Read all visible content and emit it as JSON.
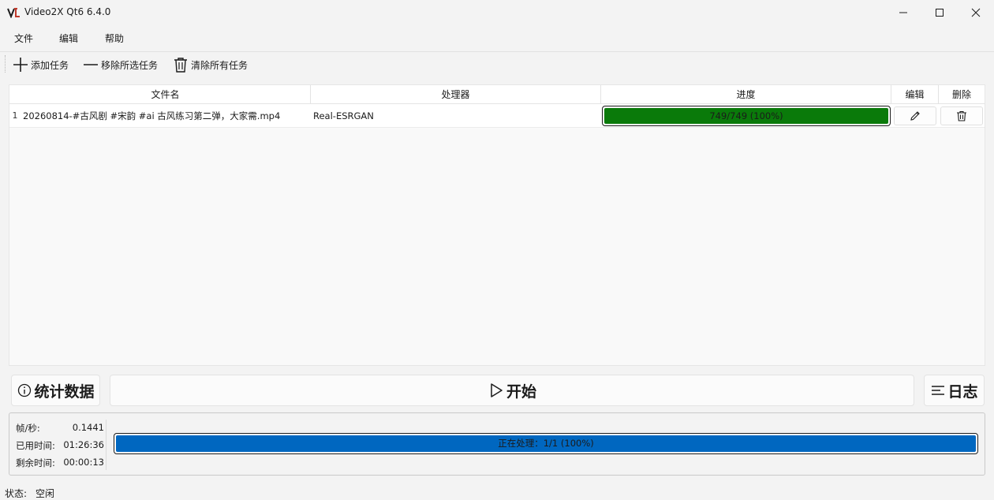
{
  "window": {
    "title": "Video2X Qt6 6.4.0"
  },
  "menu": {
    "items": [
      "文件",
      "编辑",
      "帮助"
    ]
  },
  "toolbar": {
    "add_task": "添加任务",
    "remove_selected": "移除所选任务",
    "clear_all": "清除所有任务"
  },
  "table": {
    "columns": [
      "文件名",
      "处理器",
      "进度",
      "编辑",
      "删除"
    ],
    "rows": [
      {
        "index": "1",
        "filename": "20260814-#古风剧 #宋韵 #ai 古风练习第二弹，大家需.mp4",
        "processor": "Real-ESRGAN",
        "progress_text": "749/749 (100%)",
        "progress_fraction": 1.0
      }
    ]
  },
  "actions": {
    "stats": "统计数据",
    "start": "开始",
    "log": "日志"
  },
  "stats": {
    "fps_label": "帧/秒:",
    "fps_value": "0.1441",
    "elapsed_label": "已用时间:",
    "elapsed_value": "01:26:36",
    "remaining_label": "剩余时间:",
    "remaining_value": "00:00:13"
  },
  "overall": {
    "text": "正在处理：1/1 (100%)",
    "fraction": 1.0
  },
  "status": {
    "label": "状态:",
    "value": "空闲"
  },
  "colors": {
    "task_progress": "#0a7a0a",
    "overall_progress": "#0067c0"
  }
}
